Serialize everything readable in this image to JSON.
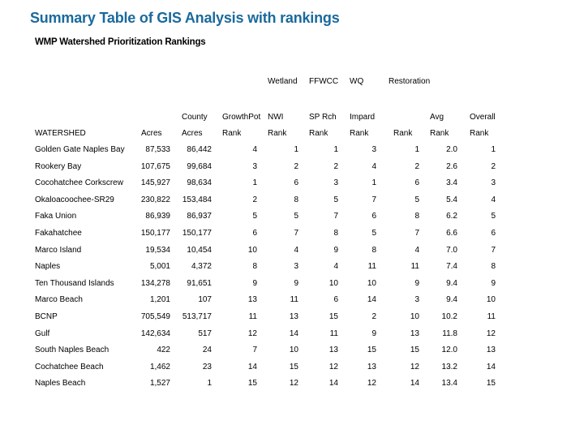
{
  "title": "Summary Table of GIS Analysis with rankings",
  "subtitle": "WMP Watershed Prioritization Rankings",
  "accent_color": "#1a6a9c",
  "header": {
    "row1": {
      "wetland": "Wetland",
      "ffwcc": "FFWCC",
      "wq": "WQ",
      "restoration": "Restoration"
    },
    "row2": {
      "county": "County",
      "growthpot": "GrowthPot",
      "nwi": "NWI",
      "sprch": "SP Rch",
      "impard": "Impard",
      "avg": "Avg",
      "overall": "Overall"
    },
    "row3": {
      "watershed": "WATERSHED",
      "acres": "Acres",
      "county_acres": "Acres",
      "growth_rank": "Rank",
      "nwi_rank": "Rank",
      "sprch_rank": "Rank",
      "impard_rank": "Rank",
      "restoration_rank": "Rank",
      "avg_rank": "Rank",
      "overall_rank": "Rank"
    }
  },
  "rows": [
    {
      "watershed": "Golden Gate Naples Bay",
      "acres": "87,533",
      "county_acres": "86,442",
      "growth": "4",
      "nwi": "1",
      "sprch": "1",
      "impard": "3",
      "restoration": "1",
      "avg": "2.0",
      "overall": "1"
    },
    {
      "watershed": "Rookery Bay",
      "acres": "107,675",
      "county_acres": "99,684",
      "growth": "3",
      "nwi": "2",
      "sprch": "2",
      "impard": "4",
      "restoration": "2",
      "avg": "2.6",
      "overall": "2"
    },
    {
      "watershed": "Cocohatchee Corkscrew",
      "acres": "145,927",
      "county_acres": "98,634",
      "growth": "1",
      "nwi": "6",
      "sprch": "3",
      "impard": "1",
      "restoration": "6",
      "avg": "3.4",
      "overall": "3"
    },
    {
      "watershed": "Okaloacoochee-SR29",
      "acres": "230,822",
      "county_acres": "153,484",
      "growth": "2",
      "nwi": "8",
      "sprch": "5",
      "impard": "7",
      "restoration": "5",
      "avg": "5.4",
      "overall": "4"
    },
    {
      "watershed": "Faka Union",
      "acres": "86,939",
      "county_acres": "86,937",
      "growth": "5",
      "nwi": "5",
      "sprch": "7",
      "impard": "6",
      "restoration": "8",
      "avg": "6.2",
      "overall": "5"
    },
    {
      "watershed": "Fakahatchee",
      "acres": "150,177",
      "county_acres": "150,177",
      "growth": "6",
      "nwi": "7",
      "sprch": "8",
      "impard": "5",
      "restoration": "7",
      "avg": "6.6",
      "overall": "6"
    },
    {
      "watershed": "Marco Island",
      "acres": "19,534",
      "county_acres": "10,454",
      "growth": "10",
      "nwi": "4",
      "sprch": "9",
      "impard": "8",
      "restoration": "4",
      "avg": "7.0",
      "overall": "7"
    },
    {
      "watershed": "Naples",
      "acres": "5,001",
      "county_acres": "4,372",
      "growth": "8",
      "nwi": "3",
      "sprch": "4",
      "impard": "11",
      "restoration": "11",
      "avg": "7.4",
      "overall": "8"
    },
    {
      "watershed": "Ten Thousand Islands",
      "acres": "134,278",
      "county_acres": "91,651",
      "growth": "9",
      "nwi": "9",
      "sprch": "10",
      "impard": "10",
      "restoration": "9",
      "avg": "9.4",
      "overall": "9"
    },
    {
      "watershed": "Marco Beach",
      "acres": "1,201",
      "county_acres": "107",
      "growth": "13",
      "nwi": "11",
      "sprch": "6",
      "impard": "14",
      "restoration": "3",
      "avg": "9.4",
      "overall": "10"
    },
    {
      "watershed": "BCNP",
      "acres": "705,549",
      "county_acres": "513,717",
      "growth": "11",
      "nwi": "13",
      "sprch": "15",
      "impard": "2",
      "restoration": "10",
      "avg": "10.2",
      "overall": "11"
    },
    {
      "watershed": "Gulf",
      "acres": "142,634",
      "county_acres": "517",
      "growth": "12",
      "nwi": "14",
      "sprch": "11",
      "impard": "9",
      "restoration": "13",
      "avg": "11.8",
      "overall": "12"
    },
    {
      "watershed": "South Naples Beach",
      "acres": "422",
      "county_acres": "24",
      "growth": "7",
      "nwi": "10",
      "sprch": "13",
      "impard": "15",
      "restoration": "15",
      "avg": "12.0",
      "overall": "13"
    },
    {
      "watershed": "Cochatchee Beach",
      "acres": "1,462",
      "county_acres": "23",
      "growth": "14",
      "nwi": "15",
      "sprch": "12",
      "impard": "13",
      "restoration": "12",
      "avg": "13.2",
      "overall": "14"
    },
    {
      "watershed": "Naples Beach",
      "acres": "1,527",
      "county_acres": "1",
      "growth": "15",
      "nwi": "12",
      "sprch": "14",
      "impard": "12",
      "restoration": "14",
      "avg": "13.4",
      "overall": "15"
    }
  ]
}
